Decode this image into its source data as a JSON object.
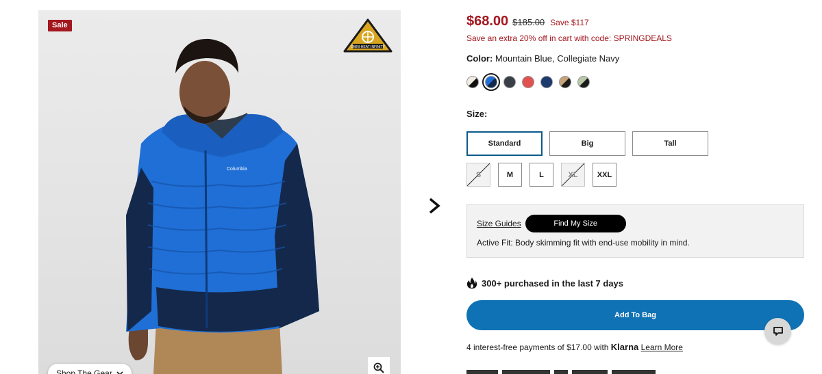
{
  "gallery": {
    "sale_badge": "Sale",
    "tech_badge_text": "OMNI-HEAT INFINITY",
    "shop_the_gear_label": "Shop The Gear",
    "zoom_icon": "magnifier-plus-icon",
    "next_icon": "chevron-right-icon"
  },
  "price": {
    "current": "$68.00",
    "original": "$185.00",
    "savings": "Save $117",
    "promo": "Save an extra 20% off in cart with code: SPRINGDEALS"
  },
  "color": {
    "label": "Color:",
    "value": "Mountain Blue, Collegiate Navy",
    "swatches": [
      {
        "a": "#f1ece2",
        "b": "#111111"
      },
      {
        "a": "#1f6fd6",
        "b": "#14284b",
        "selected": true
      },
      {
        "a": "#3a3f47",
        "b": "#3a3f47"
      },
      {
        "a": "#e0524e",
        "b": "#e0524e"
      },
      {
        "a": "#1d3a6e",
        "b": "#1d3a6e"
      },
      {
        "a": "#c7a37a",
        "b": "#1b1b1b"
      },
      {
        "a": "#b8c9a8",
        "b": "#1b1b1b"
      }
    ]
  },
  "size": {
    "label": "Size:",
    "fits": [
      "Standard",
      "Big",
      "Tall"
    ],
    "selected_fit": "Standard",
    "sizes": [
      {
        "label": "S",
        "available": false
      },
      {
        "label": "M",
        "available": true
      },
      {
        "label": "L",
        "available": true
      },
      {
        "label": "XL",
        "available": false
      },
      {
        "label": "XXL",
        "available": true
      }
    ]
  },
  "fit_info": {
    "size_guides": "Size Guides",
    "find_my_size": "Find My Size",
    "note": "Active Fit: Body skimming fit with end-use mobility in mind."
  },
  "social_proof": {
    "icon": "flame-icon",
    "text": "300+ purchased in the last 7 days"
  },
  "cart": {
    "add_to_bag": "Add To Bag"
  },
  "financing": {
    "text": "4 interest-free payments of $17.00 with",
    "brand": "Klarna",
    "learn_more": "Learn More"
  },
  "chat": {
    "icon": "chat-bubble-icon"
  }
}
